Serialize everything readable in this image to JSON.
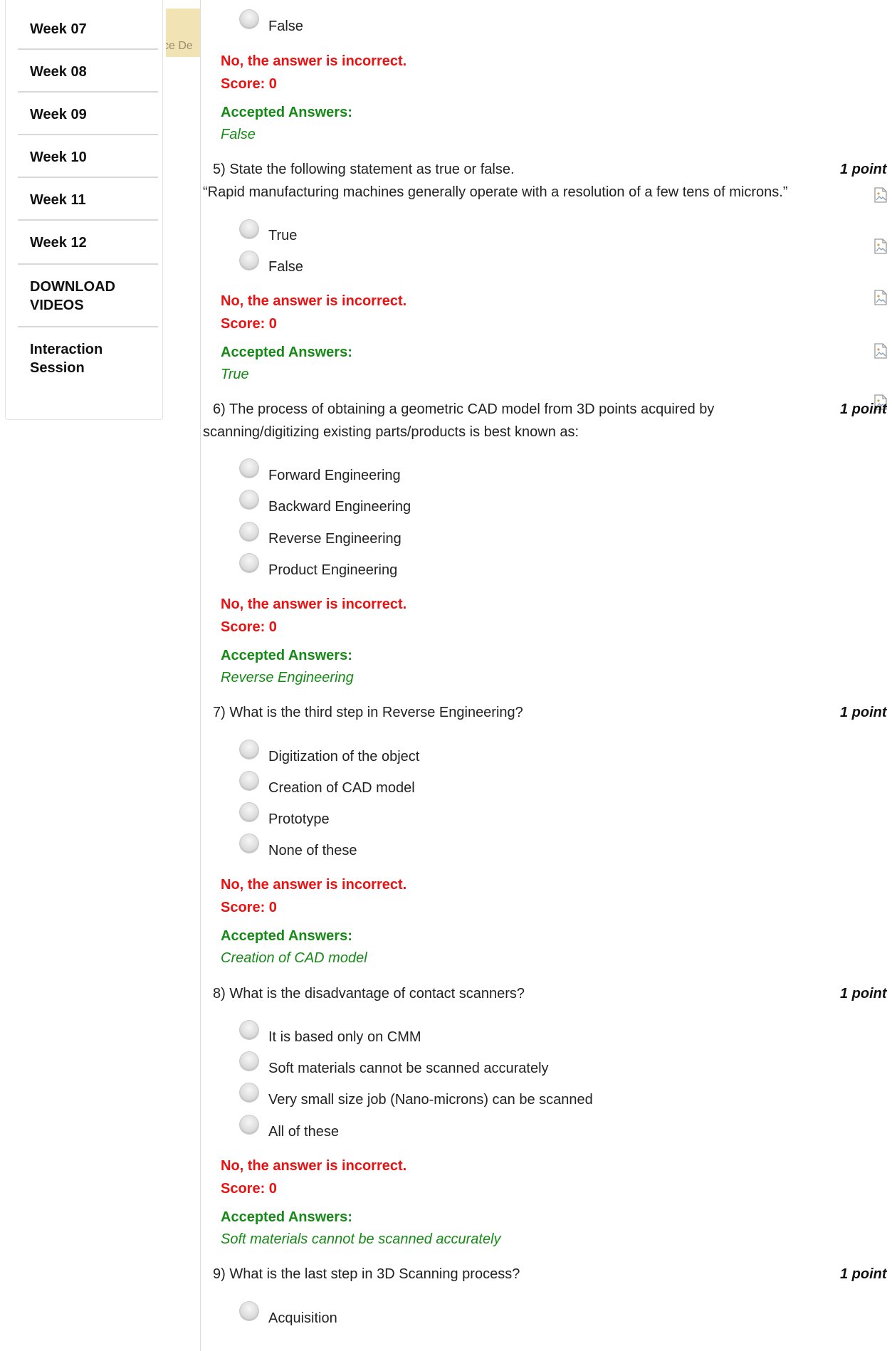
{
  "sidebar": {
    "items": [
      {
        "label_lines": [
          "Week 07"
        ]
      },
      {
        "label_lines": [
          "Week 08"
        ]
      },
      {
        "label_lines": [
          "Week 09"
        ]
      },
      {
        "label_lines": [
          "Week 10"
        ]
      },
      {
        "label_lines": [
          "Week 11"
        ]
      },
      {
        "label_lines": [
          "Week 12"
        ]
      },
      {
        "label_lines": [
          "DOWNLOAD",
          "VIDEOS"
        ]
      },
      {
        "label_lines": [
          "Interaction",
          "Session"
        ]
      }
    ]
  },
  "course_tab": {
    "text": "ce De"
  },
  "q4": {
    "option_false": "False",
    "feedback": "No, the answer is incorrect.",
    "score": "Score: 0",
    "accepted_label": "Accepted Answers:",
    "accepted": "False"
  },
  "q5": {
    "question": "5) State the following statement as true or false.",
    "statement": "“Rapid manufacturing machines generally operate with a resolution of a few tens of microns.”",
    "points": "1 point",
    "options": [
      "True",
      "False"
    ],
    "feedback": "No, the answer is incorrect.",
    "score": "Score: 0",
    "accepted_label": "Accepted Answers:",
    "accepted": "True"
  },
  "q6": {
    "question_line1": "6) The process of obtaining a geometric CAD model from 3D points acquired by",
    "question_line2": "scanning/digitizing existing parts/products is best known as:",
    "points": "1 point",
    "options": [
      "Forward Engineering",
      "Backward Engineering",
      "Reverse Engineering",
      "Product Engineering"
    ],
    "feedback": "No, the answer is incorrect.",
    "score": "Score: 0",
    "accepted_label": "Accepted Answers:",
    "accepted": "Reverse Engineering"
  },
  "q7": {
    "question": "7) What is the third step in Reverse Engineering?",
    "points": "1 point",
    "options": [
      "Digitization of the object",
      "Creation of CAD model",
      "Prototype",
      "None of these"
    ],
    "feedback": "No, the answer is incorrect.",
    "score": "Score: 0",
    "accepted_label": "Accepted Answers:",
    "accepted": "Creation of CAD model"
  },
  "q8": {
    "question": "8) What is the disadvantage of contact scanners?",
    "points": "1 point",
    "options": [
      "It is based only on CMM",
      "Soft materials cannot be scanned accurately",
      "Very small size job (Nano-microns) can be scanned",
      "All of these"
    ],
    "feedback": "No, the answer is incorrect.",
    "score": "Score: 0",
    "accepted_label": "Accepted Answers:",
    "accepted": "Soft materials cannot be scanned accurately"
  },
  "q9": {
    "question": "9) What is the last step in 3D Scanning process?",
    "points": "1 point",
    "options": [
      "Acquisition"
    ]
  }
}
